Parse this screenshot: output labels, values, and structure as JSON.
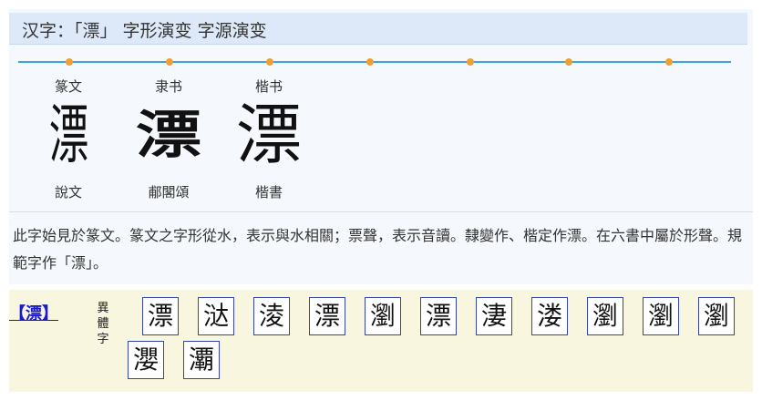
{
  "header": {
    "title": "汉字：「漂」 字形演变 字源演变"
  },
  "timeline": {
    "line_color": "#3ca6dc",
    "dot_color": "#f0a030"
  },
  "evolution": [
    {
      "era": "篆文",
      "glyph": "漂",
      "source": "說文"
    },
    {
      "era": "隶书",
      "glyph": "漂",
      "source": "郙閣頌"
    },
    {
      "era": "楷书",
      "glyph": "漂",
      "source": "楷書"
    }
  ],
  "description": "此字始見於篆文。篆文之字形從水，表示與水相關；票聲，表示音讀。隸變作、楷定作漂。在六書中屬於形聲。規範字作「漂」。",
  "variants": {
    "heading": "【漂】",
    "label": "異體字",
    "chars": [
      "漂",
      "㳠",
      "淩",
      "漂",
      "瀏",
      "漂",
      "淒",
      "溇",
      "瀏",
      "瀏",
      "瀏",
      "瀴",
      "㶚"
    ],
    "link_color": "#1a1ad0",
    "box_border": "#3344aa"
  }
}
